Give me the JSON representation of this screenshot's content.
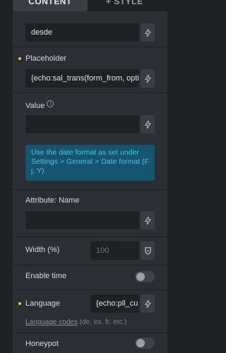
{
  "tabs": {
    "content": "CONTENT",
    "style": "+ STYLE"
  },
  "fields": {
    "top_value": "desde",
    "placeholder_label": "Placeholder",
    "placeholder_value": "{echo:sal_trans(form_from, opti",
    "value_label": "Value",
    "value_info": "i",
    "value_value": "",
    "notice": "Use the date format as set under Settings > General > Date format (F j, Y)",
    "attribute_name_label": "Attribute: Name",
    "attribute_name_value": "",
    "width_label": "Width (%)",
    "width_placeholder": "100",
    "enable_time_label": "Enable time",
    "language_label": "Language",
    "language_value": "{echo:pll_cu",
    "language_codes_link": "Language codes",
    "language_codes_examples": "(de, es, fr, etc.)",
    "honeypot_label": "Honeypot"
  },
  "toggles": {
    "enable_time": false,
    "honeypot": false
  },
  "colors": {
    "modified_dot": "#f5c542",
    "notice_bg": "#16556f",
    "notice_text": "#4ac3e8"
  }
}
